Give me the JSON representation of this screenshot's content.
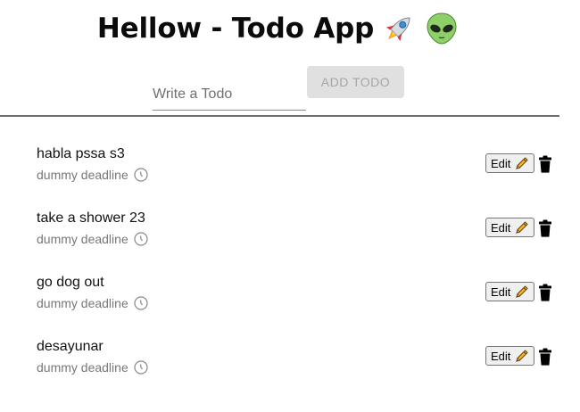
{
  "header": {
    "title": "Hellow - Todo App",
    "emojis": [
      "rocket-icon",
      "alien-icon"
    ]
  },
  "form": {
    "input_value": "",
    "input_placeholder": "Write a Todo",
    "add_label": "ADD TODO"
  },
  "todos": [
    {
      "text": "habla pssa s3",
      "deadline": "dummy deadline",
      "edit_label": "Edit"
    },
    {
      "text": "take a shower 23",
      "deadline": "dummy deadline",
      "edit_label": "Edit"
    },
    {
      "text": "go dog out",
      "deadline": "dummy deadline",
      "edit_label": "Edit"
    },
    {
      "text": "desayunar",
      "deadline": "dummy deadline",
      "edit_label": "Edit"
    }
  ],
  "colors": {
    "add_button_bg": "#e0e0e0",
    "add_button_text": "#a6a6a6",
    "divider": "#6d6d6d",
    "deadline_text": "#777777"
  }
}
